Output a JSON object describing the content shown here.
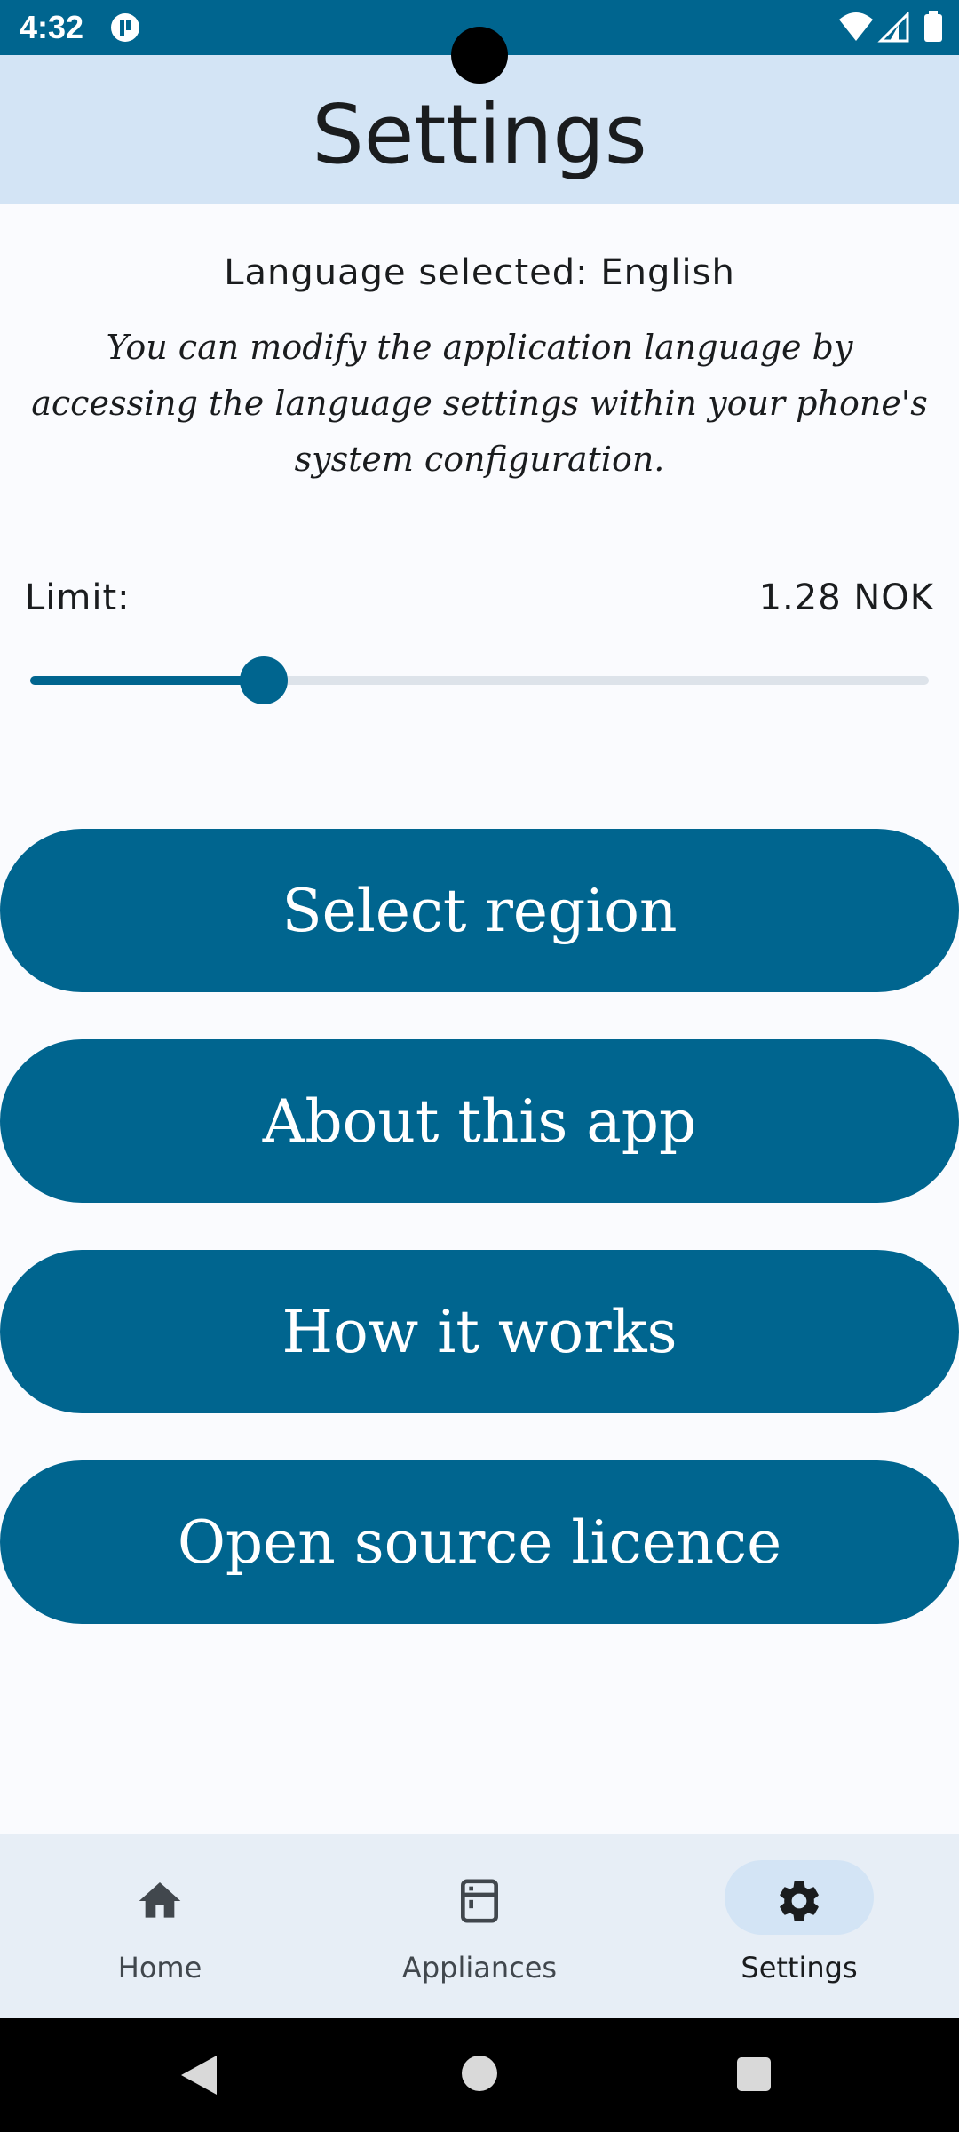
{
  "status_bar": {
    "time": "4:32"
  },
  "header": {
    "title": "Settings"
  },
  "language": {
    "selected": "Language selected: English",
    "hint": "You can modify the application language by accessing the language settings within your phone's system configuration."
  },
  "limit": {
    "label": "Limit:",
    "value": "1.28 NOK",
    "slider_fraction": 0.26
  },
  "buttons": {
    "select_region": "Select region",
    "about": "About this app",
    "how_it_works": "How it works",
    "licence": "Open source licence"
  },
  "nav": {
    "items": [
      {
        "label": "Home",
        "icon": "home-icon",
        "active": false
      },
      {
        "label": "Appliances",
        "icon": "appliance-icon",
        "active": false
      },
      {
        "label": "Settings",
        "icon": "gear-icon",
        "active": true
      }
    ]
  },
  "colors": {
    "primary": "#00658F",
    "header_bg": "#D3E4F5",
    "nav_bg": "#E7EEF6",
    "track": "#DDE3EA"
  }
}
